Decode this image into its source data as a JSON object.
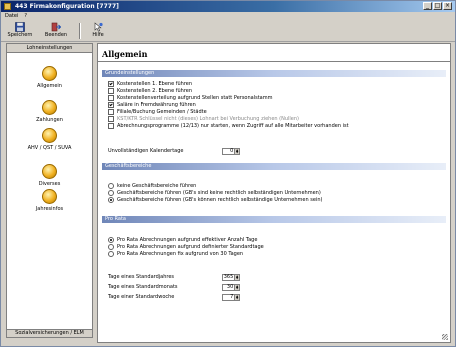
{
  "window": {
    "title": "443 Firmakonfiguration [7777]",
    "controls": {
      "minimize": "_",
      "maximize": "□",
      "close": "×"
    }
  },
  "menu": {
    "items": [
      "Datei",
      "?"
    ]
  },
  "toolbar": {
    "save_label": "Speichern",
    "exit_label": "Beenden",
    "help_label": "Hilfe",
    "save_icon": "floppy-disk-icon",
    "exit_icon": "exit-door-icon",
    "help_icon": "help-pointer-icon"
  },
  "sidebar": {
    "tab_label": "Lohneinstellungen",
    "items": [
      {
        "label": "Allgemein"
      },
      {
        "label": "Zahlungen"
      },
      {
        "label": "AHV / QST / SUVA"
      },
      {
        "label": "Diverses"
      },
      {
        "label": "Jahresinfos"
      }
    ],
    "bottom_tab_label": "Sozialversicherungen / ELM"
  },
  "main": {
    "title": "Allgemein",
    "grund": {
      "header": "Grundeinstellungen",
      "options": [
        {
          "label": "Kostenstellen 1. Ebene führen",
          "checked": true
        },
        {
          "label": "Kostenstellen 2. Ebene führen",
          "checked": false
        },
        {
          "label": "Kostenstellenverteilung aufgrund Stellen statt Personalstamm",
          "checked": false
        },
        {
          "label": "Saläre in Fremdwährung führen",
          "checked": true
        },
        {
          "label": "Filiale/Buchung Gemeinden / Städte",
          "checked": false
        },
        {
          "label": "KST/KTR Schlüssel nicht (dieses) Lohnart bei Verbuchung ziehen (Nullen)",
          "checked": false,
          "disabled": true
        },
        {
          "label": "Abrechnungsprogramme (12/13) nur starten, wenn Zugriff auf alle Mitarbeiter vorhanden ist",
          "checked": false
        }
      ],
      "calendar_label": "Unvollständigen Kalendertage",
      "calendar_value": "0"
    },
    "geschaeft": {
      "header": "Geschäftsbereiche",
      "options": [
        {
          "label": "keine Geschäftsbereiche führen",
          "selected": false
        },
        {
          "label": "Geschäftsbereiche führen (GB's sind keine rechtlich selbständigen Unternehmen)",
          "selected": false
        },
        {
          "label": "Geschäftsbereiche führen (GB's können rechtlich selbständige Unternehmen sein)",
          "selected": true
        }
      ]
    },
    "prorata": {
      "header": "Pro Rata",
      "options": [
        {
          "label": "Pro Rata Abrechnungen aufgrund effektiver Anzahl Tage",
          "selected": true
        },
        {
          "label": "Pro Rata Abrechnungen aufgrund definierter Standardtage",
          "selected": false
        },
        {
          "label": "Pro Rata Abrechnungen fix aufgrund von 30 Tagen",
          "selected": false
        }
      ],
      "fields": [
        {
          "label": "Tage eines Standardjahres",
          "value": "365"
        },
        {
          "label": "Tage eines Standardmonats",
          "value": "30"
        },
        {
          "label": "Tage einer Standardwoche",
          "value": "7"
        }
      ]
    }
  }
}
